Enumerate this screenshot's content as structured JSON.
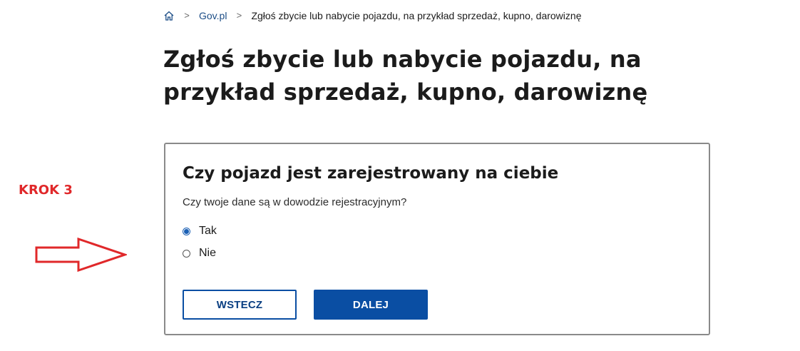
{
  "breadcrumb": {
    "home_icon": "home-icon",
    "separator": ">",
    "items": [
      {
        "label": "Gov.pl"
      },
      {
        "label": "Zgłoś zbycie lub nabycie pojazdu, na przykład sprzedaż, kupno, darowiznę"
      }
    ]
  },
  "page": {
    "title": "Zgłoś zbycie lub nabycie pojazdu, na przykład sprzedaż, kupno, darowiznę"
  },
  "annotation": {
    "step_label": "KROK 3",
    "arrow_icon": "arrow-right-icon",
    "color": "#e0282a"
  },
  "form": {
    "title": "Czy pojazd jest zarejestrowany na ciebie",
    "question": "Czy twoje dane są w dowodzie rejestracyjnym?",
    "options": [
      {
        "label": "Tak",
        "selected": true
      },
      {
        "label": "Nie",
        "selected": false
      }
    ],
    "back_label": "WSTECZ",
    "next_label": "DALEJ"
  },
  "colors": {
    "accent": "#0a4ea3",
    "link": "#1c4d86",
    "border": "#8a8a8a"
  }
}
